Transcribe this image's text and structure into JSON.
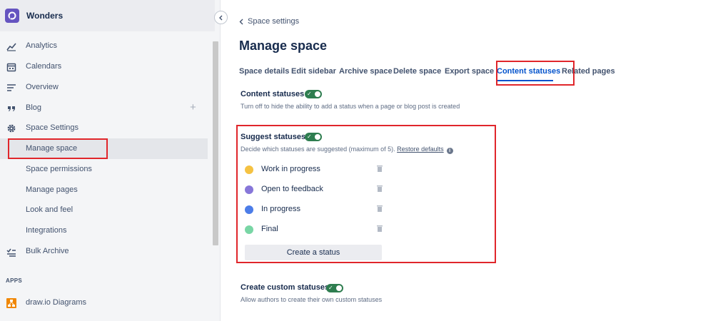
{
  "space": {
    "name": "Wonders"
  },
  "sidebar": {
    "items": [
      {
        "label": "Analytics"
      },
      {
        "label": "Calendars"
      },
      {
        "label": "Overview"
      },
      {
        "label": "Blog"
      },
      {
        "label": "Space Settings"
      },
      {
        "label": "Manage space"
      },
      {
        "label": "Space permissions"
      },
      {
        "label": "Manage pages"
      },
      {
        "label": "Look and feel"
      },
      {
        "label": "Integrations"
      },
      {
        "label": "Bulk Archive"
      }
    ],
    "apps_label": "APPS",
    "apps": [
      {
        "label": "draw.io Diagrams"
      }
    ]
  },
  "breadcrumb": {
    "label": "Space settings"
  },
  "page": {
    "title": "Manage space"
  },
  "tabs": [
    {
      "label": "Space details"
    },
    {
      "label": "Edit sidebar"
    },
    {
      "label": "Archive space"
    },
    {
      "label": "Delete space"
    },
    {
      "label": "Export space"
    },
    {
      "label": "Content statuses",
      "active": true
    },
    {
      "label": "Related pages"
    }
  ],
  "content_statuses": {
    "title": "Content statuses",
    "enabled": true,
    "description": "Turn off to hide the ability to add a status when a page or blog post is created"
  },
  "suggest_statuses": {
    "title": "Suggest statuses",
    "enabled": true,
    "description": "Decide which statuses are suggested (maximum of 5).",
    "restore_link": "Restore defaults",
    "statuses": [
      {
        "label": "Work in progress",
        "color": "#f5c242"
      },
      {
        "label": "Open to feedback",
        "color": "#8777d9"
      },
      {
        "label": "In progress",
        "color": "#4c7de8"
      },
      {
        "label": "Final",
        "color": "#79d6a5"
      }
    ],
    "create_button": "Create a status"
  },
  "custom_statuses": {
    "title": "Create custom statuses",
    "enabled": true,
    "description": "Allow authors to create their own custom statuses"
  },
  "colors": {
    "toggle_on": "#2e7d4f",
    "active_tab": "#0052cc",
    "highlight": "#e0262b",
    "space_logo": "#6554c0"
  }
}
